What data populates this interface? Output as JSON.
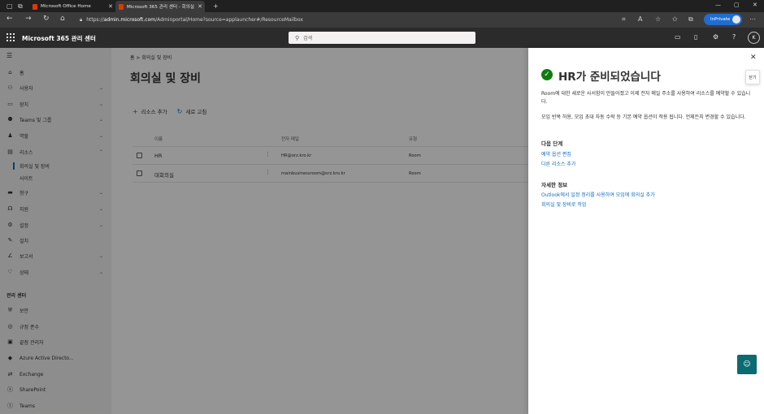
{
  "browser": {
    "tabs": [
      {
        "title": "Microsoft Office Home"
      },
      {
        "title": "Microsoft 365 관리 센터 - 회의실"
      }
    ],
    "url_prefix": "https://",
    "url_domain": "admin.microsoft.com",
    "url_path": "/Adminportal/Home?source=applauncher#/ResourceMailbox",
    "inprivate": "InPrivate"
  },
  "header": {
    "app_title": "Microsoft 365 관리 센터",
    "search_placeholder": "검색",
    "account_initial": "K"
  },
  "nav": {
    "items": [
      {
        "label": "홈"
      },
      {
        "label": "사용자"
      },
      {
        "label": "장치"
      },
      {
        "label": "Teams 및 그룹"
      },
      {
        "label": "역할"
      },
      {
        "label": "리소스"
      },
      {
        "label": "청구"
      },
      {
        "label": "지원"
      },
      {
        "label": "설정"
      },
      {
        "label": "설치"
      },
      {
        "label": "보고서"
      },
      {
        "label": "상태"
      }
    ],
    "sub_items": [
      {
        "label": "회의실 및 장비"
      },
      {
        "label": "사이트"
      }
    ],
    "admin_header": "관리 센터",
    "admin_items": [
      {
        "label": "보안"
      },
      {
        "label": "규정 준수"
      },
      {
        "label": "끝점 관리자"
      },
      {
        "label": "Azure Active Directo..."
      },
      {
        "label": "Exchange"
      },
      {
        "label": "SharePoint"
      },
      {
        "label": "Teams"
      }
    ]
  },
  "main": {
    "breadcrumb": "홈  >  회의실 및 장비",
    "title": "회의실 및 장비",
    "commands": {
      "add": "리소스 추가",
      "refresh": "새로 고침"
    },
    "columns": {
      "name": "이름",
      "email": "전자 메일",
      "type": "유형"
    },
    "rows": [
      {
        "name": "HR",
        "email": "HR@orz.kro.kr",
        "type": "Room"
      },
      {
        "name": "대회의실",
        "email": "mainbusinessroom@orz.kro.kr",
        "type": "Room"
      }
    ]
  },
  "panel": {
    "title": "HR가 준비되었습니다",
    "para1": "Room에 대한 새로운 사서함이 만들어졌고 이제 전자 메일 주소를 사용하여 리소스를 예약할 수 있습니다.",
    "para2": "모임 반복 허용, 모임 초대 자동 수락 등 기본 예약 옵션이 적용 됩니다. 언제든지 변경할 수 있습니다.",
    "next_steps": "다음 단계",
    "next_links": [
      "예약 옵션 편집",
      "다른 리소스 추가"
    ],
    "more_info": "자세한 정보",
    "info_links": [
      "Outlook에서 일정 정리를 사용하여 모임에 회의실 추가",
      "회의실 및 장비로 작업"
    ],
    "feedback": "닫기"
  }
}
